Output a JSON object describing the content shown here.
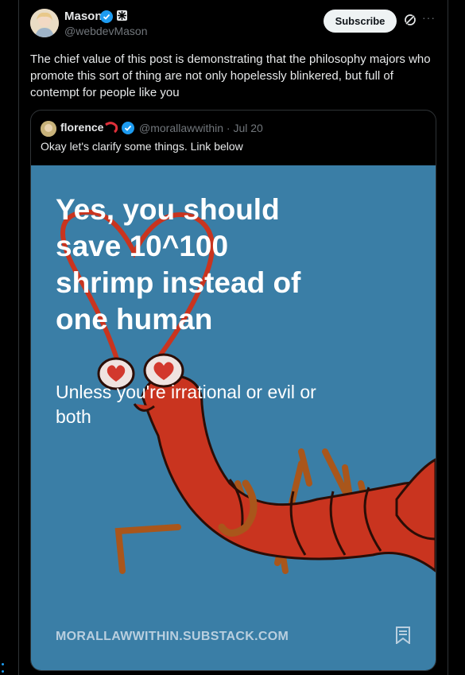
{
  "post": {
    "author_name": "Mason",
    "author_handle": "@webdevMason",
    "subscribe_label": "Subscribe",
    "more_label": "···",
    "text": "The chief value of this post is demonstrating that the philosophy majors who promote this sort of thing are not only hopelessly blinkered, but full of contempt for people like you"
  },
  "quote": {
    "author_name": "florence",
    "author_handle": "@morallawwithin · Jul 20",
    "text": "Okay let's clarify some things. Link below",
    "image": {
      "headline": "Yes, you should save 10^100 shrimp instead of one human",
      "subhead": "Unless you're irrational or evil or both",
      "site": "MORALLAWWITHIN.SUBSTACK.COM"
    }
  },
  "icons": {
    "verified": "verified-badge-icon",
    "affiliate": "affiliate-badge-icon",
    "grok": "grok-icon",
    "more": "more-icon",
    "shrimp_emoji": "shrimp-icon",
    "bookmark": "bookmark-icon"
  },
  "colors": {
    "background": "#000000",
    "accent": "#1d9bf0",
    "image_bg": "#3a7ea6",
    "shrimp": "#c9341f"
  }
}
